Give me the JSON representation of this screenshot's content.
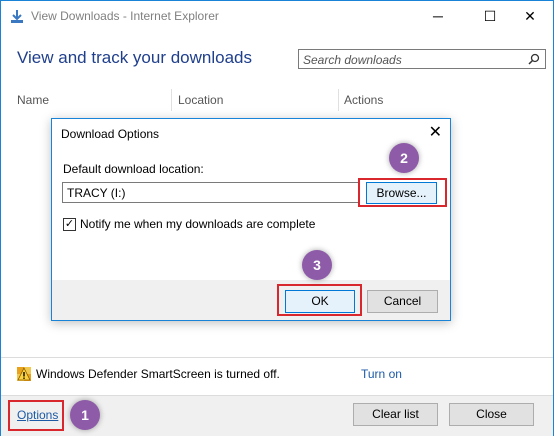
{
  "window": {
    "title": "View Downloads - Internet Explorer",
    "heading": "View and track your downloads",
    "minimize": "─",
    "maximize": "☐",
    "close": "✕"
  },
  "search": {
    "placeholder": "Search downloads"
  },
  "columns": [
    "Name",
    "Location",
    "Actions"
  ],
  "status": {
    "text": "Windows Defender SmartScreen is turned off.",
    "turn_on": "Turn on"
  },
  "footer": {
    "options": "Options",
    "clear_list": "Clear list",
    "close": "Close"
  },
  "dialog": {
    "title": "Download Options",
    "close": "✕",
    "location_label": "Default download location:",
    "location_value": "TRACY (I:)",
    "browse": "Browse...",
    "notify_label": "Notify me when my downloads are complete",
    "notify_checked": "✓",
    "ok": "OK",
    "cancel": "Cancel"
  },
  "callouts": [
    "1",
    "2",
    "3"
  ],
  "colors": {
    "accent": "#1883d7",
    "highlight": "#d9272e",
    "badge": "#8e5ba8",
    "link": "#1c5aa6"
  }
}
